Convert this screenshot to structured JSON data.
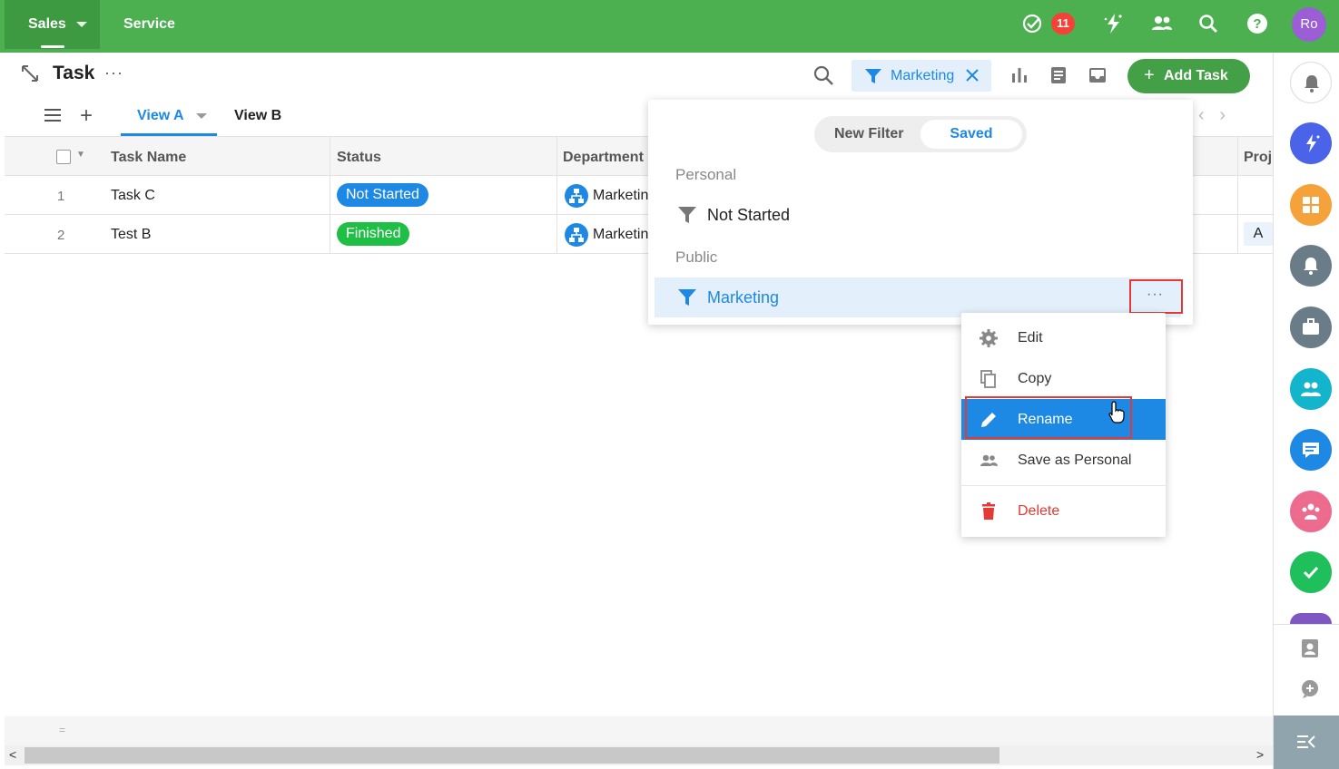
{
  "topbar": {
    "modules": [
      {
        "label": "Sales"
      },
      {
        "label": "Service"
      }
    ],
    "badge_count": "11",
    "avatar_initials": "Ro"
  },
  "header": {
    "title": "Task",
    "more": "···",
    "active_filter": "Marketing",
    "add_task_label": "Add Task",
    "add_task_plus": "+"
  },
  "views": {
    "tabs": [
      {
        "label": "View A",
        "active": true
      },
      {
        "label": "View B"
      }
    ]
  },
  "table": {
    "columns": [
      "Task Name",
      "Status",
      "Department",
      "Proj"
    ],
    "rows": [
      {
        "num": "1",
        "name": "Task C",
        "status": "Not Started",
        "status_color": "#1e88e5",
        "department": "Marketing",
        "proj": ""
      },
      {
        "num": "2",
        "name": "Test B",
        "status": "Finished",
        "status_color": "#1fbf45",
        "department": "Marketing",
        "proj": "A"
      }
    ]
  },
  "filter_panel": {
    "segments": {
      "new": "New Filter",
      "saved": "Saved"
    },
    "personal_label": "Personal",
    "personal_items": [
      {
        "label": "Not Started"
      }
    ],
    "public_label": "Public",
    "public_items": [
      {
        "label": "Marketing",
        "selected": true
      }
    ],
    "more": "···"
  },
  "context_menu": {
    "items": [
      {
        "label": "Edit",
        "icon": "gear-icon"
      },
      {
        "label": "Copy",
        "icon": "copy-icon"
      },
      {
        "label": "Rename",
        "icon": "pencil-icon",
        "active": true
      },
      {
        "label": "Save as Personal",
        "icon": "people-icon"
      },
      {
        "label": "Delete",
        "icon": "trash-icon",
        "danger": true
      }
    ]
  },
  "colors": {
    "topbar": "#4caf50",
    "accent": "#1e88e5",
    "danger": "#e53935",
    "add_button": "#43a047"
  },
  "right_sidebar": {
    "buttons": [
      {
        "icon": "bell-icon",
        "color": "#ffffff"
      },
      {
        "icon": "ai-spark-icon",
        "color": "#4a63e8"
      },
      {
        "icon": "apps-grid-icon",
        "color": "#f5a23a"
      },
      {
        "icon": "notification-icon",
        "color": "#6b7c89"
      },
      {
        "icon": "briefcase-icon",
        "color": "#6b7c89"
      },
      {
        "icon": "team-icon",
        "color": "#12b5cb"
      },
      {
        "icon": "chat-icon",
        "color": "#1e88e5"
      },
      {
        "icon": "group-icon",
        "color": "#ec6b8e"
      },
      {
        "icon": "check-circle-icon",
        "color": "#1fbf5b"
      }
    ]
  }
}
